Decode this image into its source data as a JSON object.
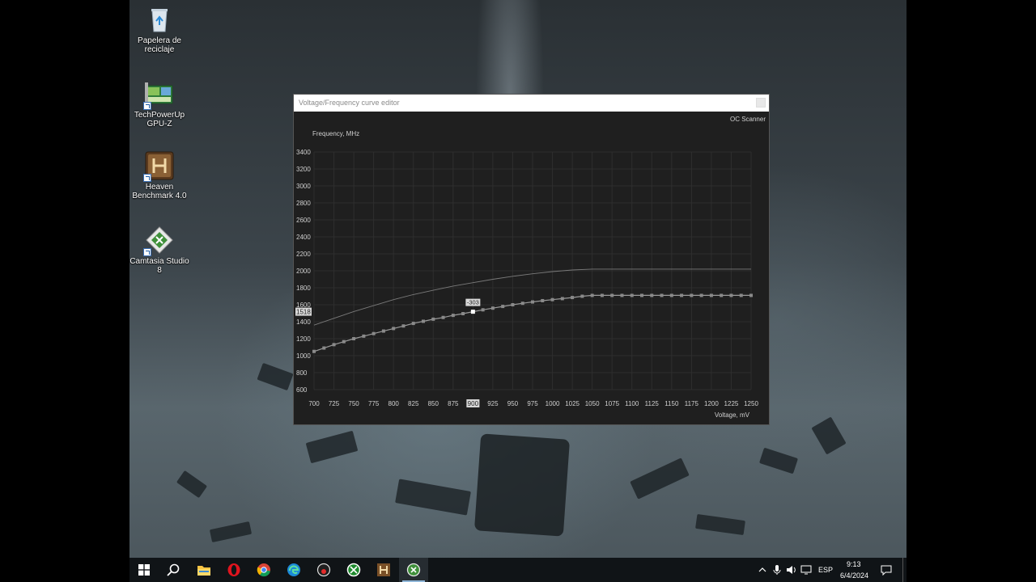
{
  "desktop": {
    "icons": [
      {
        "name": "recycle-bin",
        "label": "Papelera de reciclaje"
      },
      {
        "name": "gpuz",
        "label": "TechPowerUp GPU-Z"
      },
      {
        "name": "heaven",
        "label": "Heaven Benchmark 4.0"
      },
      {
        "name": "camtasia",
        "label": "Camtasia Studio 8"
      }
    ]
  },
  "window": {
    "title": "Voltage/Frequency curve editor",
    "oc_scanner_label": "OC Scanner",
    "selected_point_label": "-303",
    "selected_freq_label": "1518",
    "selected_voltage_label": "900"
  },
  "chart_data": {
    "type": "line",
    "ylabel": "Frequency, MHz",
    "xlabel": "Voltage, mV",
    "xlim": [
      700,
      1250
    ],
    "ylim": [
      600,
      3400
    ],
    "x_ticks": [
      700,
      725,
      750,
      775,
      800,
      825,
      850,
      875,
      900,
      925,
      950,
      975,
      1000,
      1025,
      1050,
      1075,
      1100,
      1125,
      1150,
      1175,
      1200,
      1225,
      1250
    ],
    "y_ticks": [
      3400,
      3200,
      3000,
      2800,
      2600,
      2400,
      2200,
      2000,
      1800,
      1600,
      1400,
      1200,
      1000,
      800,
      600
    ],
    "grid": true,
    "series": [
      {
        "color": "#7a7a7a",
        "x": [
          700,
          725,
          750,
          775,
          800,
          825,
          850,
          875,
          900,
          925,
          950,
          975,
          1000,
          1025,
          1050,
          1075,
          1100,
          1125,
          1150,
          1175,
          1200,
          1225,
          1250
        ],
        "y": [
          1360,
          1440,
          1520,
          1590,
          1660,
          1720,
          1770,
          1820,
          1860,
          1900,
          1935,
          1965,
          1990,
          2010,
          2020,
          2020,
          2020,
          2020,
          2020,
          2020,
          2020,
          2020,
          2020
        ]
      },
      {
        "color": "#9a9a9a",
        "markers": true,
        "x": [
          700,
          712.5,
          725,
          737.5,
          750,
          762.5,
          775,
          787.5,
          800,
          812.5,
          825,
          837.5,
          850,
          862.5,
          875,
          887.5,
          900,
          912.5,
          925,
          937.5,
          950,
          962.5,
          975,
          987.5,
          1000,
          1012.5,
          1025,
          1037.5,
          1050,
          1062.5,
          1075,
          1087.5,
          1100,
          1112.5,
          1125,
          1137.5,
          1150,
          1162.5,
          1175,
          1187.5,
          1200,
          1212.5,
          1225,
          1237.5,
          1250
        ],
        "y": [
          1050,
          1090,
          1130,
          1165,
          1200,
          1230,
          1260,
          1290,
          1320,
          1350,
          1380,
          1405,
          1430,
          1450,
          1475,
          1495,
          1518,
          1540,
          1560,
          1580,
          1600,
          1617,
          1633,
          1648,
          1660,
          1672,
          1685,
          1700,
          1710,
          1710,
          1710,
          1710,
          1710,
          1710,
          1710,
          1710,
          1710,
          1710,
          1710,
          1710,
          1710,
          1710,
          1710,
          1710,
          1710
        ]
      }
    ]
  },
  "taskbar": {
    "apps": [
      "start",
      "search",
      "file-explorer",
      "opera",
      "chrome",
      "edge",
      "app-circle",
      "xbox",
      "heaven",
      "camtasia"
    ],
    "lang": "ESP",
    "time": "9:13",
    "date": "6/4/2024"
  },
  "colors": {
    "window_bg": "#1f1f1f",
    "grid": "#2e2e2e",
    "text": "#d0d0d0"
  }
}
